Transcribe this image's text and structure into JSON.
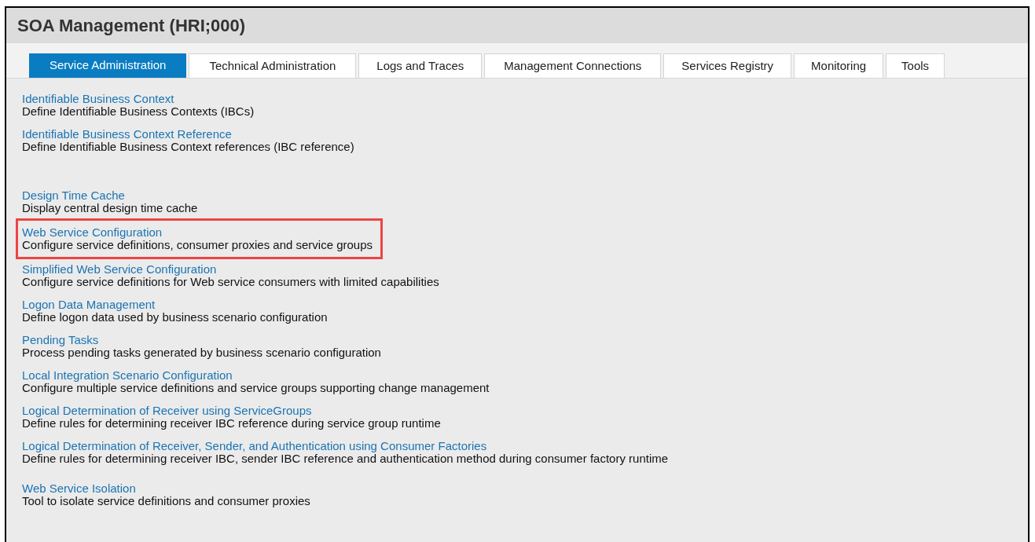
{
  "window": {
    "title": "SOA Management (HRI;000)"
  },
  "tabs": [
    {
      "label": "Service Administration",
      "selected": true
    },
    {
      "label": "Technical Administration",
      "selected": false
    },
    {
      "label": "Logs and Traces",
      "selected": false
    },
    {
      "label": "Management Connections",
      "selected": false
    },
    {
      "label": "Services Registry",
      "selected": false
    },
    {
      "label": "Monitoring",
      "selected": false
    },
    {
      "label": "Tools",
      "selected": false
    }
  ],
  "groups": [
    [
      {
        "link": "Identifiable Business Context",
        "description": "Define Identifiable Business Contexts (IBCs)",
        "highlighted": false
      },
      {
        "link": "Identifiable Business Context Reference",
        "description": "Define Identifiable Business Context references (IBC reference)",
        "highlighted": false
      }
    ],
    [
      {
        "link": "Design Time Cache",
        "description": "Display central design time cache",
        "highlighted": false
      },
      {
        "link": "Web Service Configuration",
        "description": "Configure service definitions, consumer proxies and service groups",
        "highlighted": true
      },
      {
        "link": "Simplified Web Service Configuration",
        "description": "Configure service definitions for Web service consumers with limited capabilities",
        "highlighted": false
      },
      {
        "link": "Logon Data Management",
        "description": "Define logon data used by business scenario configuration",
        "highlighted": false
      },
      {
        "link": "Pending Tasks",
        "description": "Process pending tasks generated by business scenario configuration",
        "highlighted": false
      },
      {
        "link": "Local Integration Scenario Configuration",
        "description": "Configure multiple service definitions and service groups supporting change management",
        "highlighted": false
      },
      {
        "link": "Logical Determination of Receiver using ServiceGroups",
        "description": "Define rules for determining receiver IBC reference during service group runtime",
        "highlighted": false
      },
      {
        "link": "Logical Determination of Receiver, Sender, and Authentication using Consumer Factories",
        "description": "Define rules for determining receiver IBC, sender IBC reference and authentication method during consumer factory runtime",
        "highlighted": false
      }
    ],
    [
      {
        "link": "Web Service Isolation",
        "description": "Tool to isolate service definitions and consumer proxies",
        "highlighted": false
      }
    ]
  ]
}
